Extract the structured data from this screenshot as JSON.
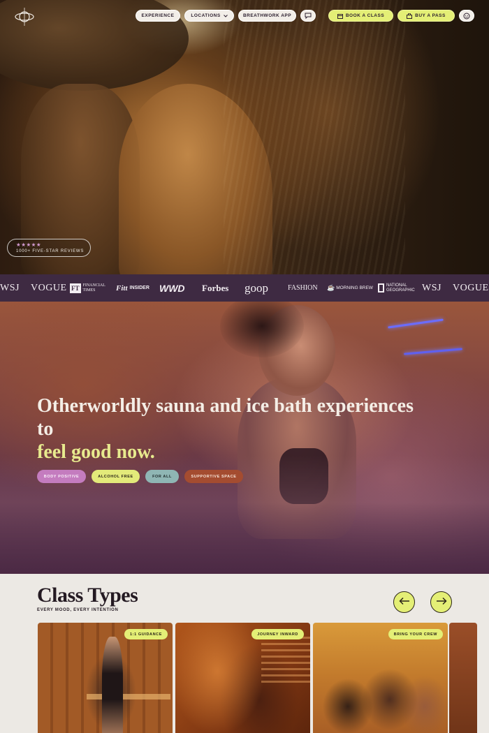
{
  "nav": {
    "left_items": [
      {
        "label": "EXPERIENCE",
        "icon": null
      },
      {
        "label": "LOCATIONS",
        "icon": "chevron-down-icon"
      },
      {
        "label": "BREATHWORK APP",
        "icon": null
      }
    ],
    "right_items": [
      {
        "label": "BOOK A CLASS",
        "icon": "calendar-icon"
      },
      {
        "label": "BUY A PASS",
        "icon": "shopping-bag-icon"
      }
    ],
    "chat_icon": "chat-bubble-icon",
    "account_icon": "user-face-icon",
    "logo_icon": "orbit-logo-icon"
  },
  "hero": {
    "reviews_stars": "★★★★★",
    "reviews_label": "1000+ FIVE-STAR REVIEWS"
  },
  "press": {
    "logos": [
      "WSJ",
      "VOGUE",
      "FT",
      "FINANCIAL TIMES",
      "Fitt",
      "INSIDER",
      "WWD",
      "Forbes",
      "goop",
      "FASHION",
      "MORNING BREW",
      "NATIONAL GEOGRAPHIC",
      "WSJ",
      "VOGUE"
    ]
  },
  "intro": {
    "headline": "Otherworldly sauna and ice bath experiences to",
    "headline_accent": "feel good now.",
    "tags": [
      "BODY POSITIVE",
      "ALCOHOL FREE",
      "FOR ALL",
      "SUPPORTIVE SPACE"
    ]
  },
  "classes": {
    "title": "Class Types",
    "subtitle": "EVERY MOOD, EVERY INTENTION",
    "cards": [
      {
        "badge": "1:1 GUIDANCE"
      },
      {
        "badge": "JOURNEY INWARD"
      },
      {
        "badge": "BRING YOUR CREW"
      }
    ]
  },
  "colors": {
    "accent_lime": "#e4ef76",
    "press_bar": "#3e2a42",
    "headline_accent": "#e7ea8e",
    "tag_pink": "#c47cbf",
    "tag_teal": "#8fb6b4",
    "tag_rust": "#a44c30",
    "page_bg": "#ece9e4"
  }
}
